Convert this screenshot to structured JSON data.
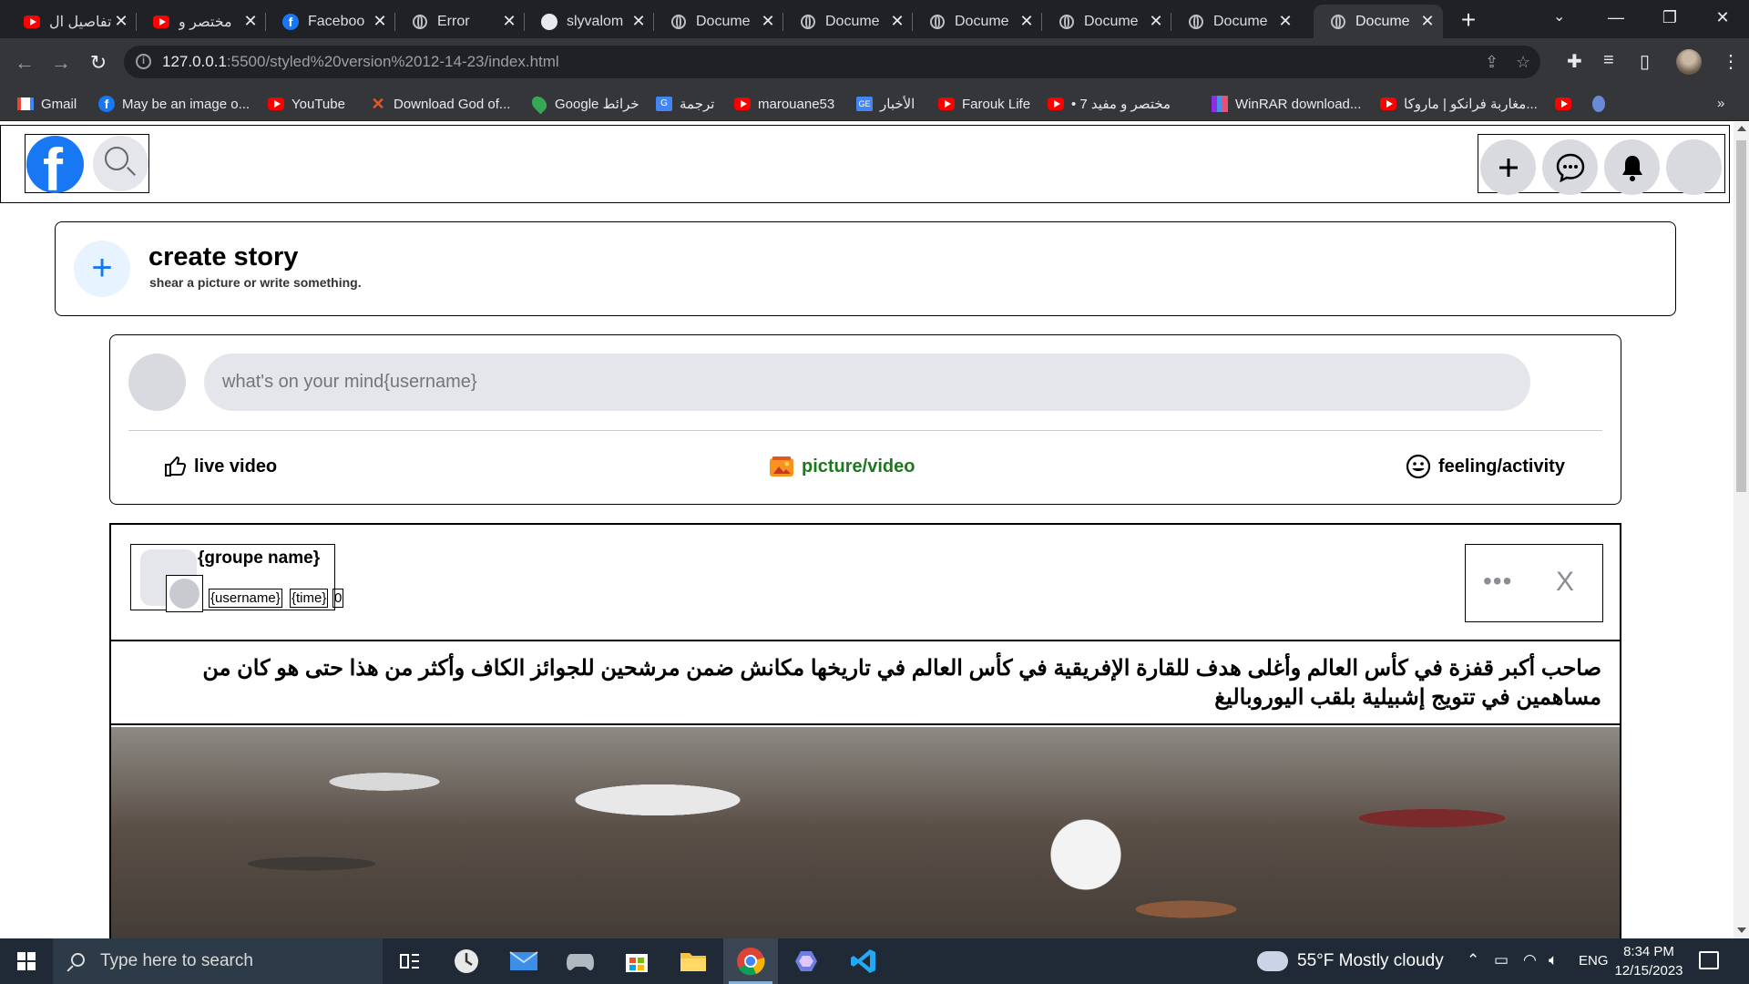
{
  "browser": {
    "tabs": [
      {
        "title": "تفاصيل ال",
        "icon": "youtube-favicon"
      },
      {
        "title": "مختصر و",
        "icon": "youtube-favicon"
      },
      {
        "title": "Faceboo",
        "icon": "facebook-favicon"
      },
      {
        "title": "Error",
        "icon": "globe-favicon"
      },
      {
        "title": "slyvalom",
        "icon": "github-favicon"
      },
      {
        "title": "Docume",
        "icon": "globe-favicon"
      },
      {
        "title": "Docume",
        "icon": "globe-favicon"
      },
      {
        "title": "Docume",
        "icon": "globe-favicon"
      },
      {
        "title": "Docume",
        "icon": "globe-favicon"
      },
      {
        "title": "Docume",
        "icon": "globe-favicon"
      },
      {
        "title": "Docume",
        "icon": "globe-favicon",
        "active": true
      }
    ],
    "url_host": "127.0.0.1",
    "url_path": ":5500/styled%20version%2012-14-23/index.html",
    "bookmarks": [
      {
        "label": "Gmail",
        "icon": "gmail-favicon"
      },
      {
        "label": "May be an image o...",
        "icon": "facebook-favicon"
      },
      {
        "label": "YouTube",
        "icon": "youtube-favicon"
      },
      {
        "label": "Download God of...",
        "icon": "x-favicon"
      },
      {
        "label": "Google خرائط",
        "icon": "maps-favicon"
      },
      {
        "label": "ترجمة",
        "icon": "translate-favicon"
      },
      {
        "label": "marouane53",
        "icon": "youtube-favicon"
      },
      {
        "label": "الأخبار",
        "icon": "news-favicon"
      },
      {
        "label": "Farouk Life",
        "icon": "youtube-favicon"
      },
      {
        "label": "• مختصر و مفيد 7",
        "icon": "youtube-favicon"
      },
      {
        "label": "WinRAR download...",
        "icon": "winrar-favicon"
      },
      {
        "label": "مغاربة فرانكو | ماروكا...",
        "icon": "youtube-favicon"
      }
    ],
    "bookmarks_more": "»"
  },
  "page": {
    "header": {
      "logo_letter": "f"
    },
    "story": {
      "plus": "+",
      "title": "create story",
      "subtitle": "shear a picture or write something."
    },
    "composer": {
      "placeholder": "what's on your mind{username}",
      "actions": [
        {
          "label": "live video",
          "icon": "thumbs-up-icon"
        },
        {
          "label": "picture/video",
          "icon": "photo-icon",
          "color": "#1b7a1b"
        },
        {
          "label": "feeling/activity",
          "icon": "smiley-icon"
        }
      ]
    },
    "post": {
      "group_name": "{groupe name}",
      "username": "{username}",
      "time": "{time}",
      "privacy": "0",
      "more": "•••",
      "close": "X",
      "text": "صاحب أكبر قفزة في كأس العالم وأغلى هدف للقارة الإفريقية في كأس العالم في تاريخها مكانش ضمن مرشحين للجوائز الكاف وأكثر من هذا حتى هو كان من مساهمين في تتويج إشبيلية بلقب اليوروباليغ"
    }
  },
  "taskbar": {
    "search_placeholder": "Type here to search",
    "weather": "55°F  Mostly cloudy",
    "language": "ENG",
    "time": "8:34 PM",
    "date": "12/15/2023"
  },
  "colors": {
    "facebook_blue": "#1877f2",
    "chrome_dark": "#202124",
    "chrome_toolbar": "#35363a"
  }
}
